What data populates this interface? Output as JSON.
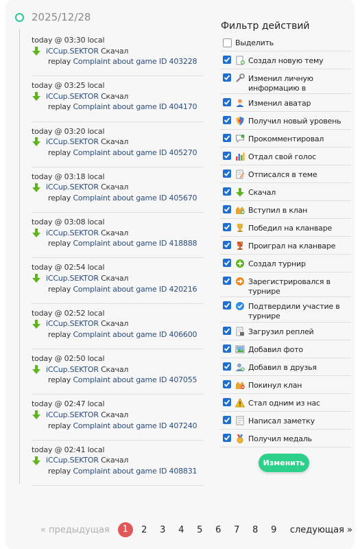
{
  "date": "2025/12/28",
  "colors": {
    "accent": "#2bc69a",
    "link": "#2a4c7d",
    "checkbox": "#1f6fd0",
    "button": "#2dd08a",
    "active_page": "#e25757"
  },
  "entries": [
    {
      "time": "today @ 03:30 local",
      "user": "iCCup.SEKTOR",
      "action": "Скачал",
      "prefix": "replay",
      "link": "Complaint about game ID 403228"
    },
    {
      "time": "today @ 03:25 local",
      "user": "iCCup.SEKTOR",
      "action": "Скачал",
      "prefix": "replay",
      "link": "Complaint about game ID 404170"
    },
    {
      "time": "today @ 03:20 local",
      "user": "iCCup.SEKTOR",
      "action": "Скачал",
      "prefix": "replay",
      "link": "Complaint about game ID 405270"
    },
    {
      "time": "today @ 03:18 local",
      "user": "iCCup.SEKTOR",
      "action": "Скачал",
      "prefix": "replay",
      "link": "Complaint about game ID 405670"
    },
    {
      "time": "today @ 03:08 local",
      "user": "iCCup.SEKTOR",
      "action": "Скачал",
      "prefix": "replay",
      "link": "Complaint about game ID 418888"
    },
    {
      "time": "today @ 02:54 local",
      "user": "iCCup.SEKTOR",
      "action": "Скачал",
      "prefix": "replay",
      "link": "Complaint about game ID 420216"
    },
    {
      "time": "today @ 02:52 local",
      "user": "iCCup.SEKTOR",
      "action": "Скачал",
      "prefix": "replay",
      "link": "Complaint about game ID 406600"
    },
    {
      "time": "today @ 02:50 local",
      "user": "iCCup.SEKTOR",
      "action": "Скачал",
      "prefix": "replay",
      "link": "Complaint about game ID 407055"
    },
    {
      "time": "today @ 02:47 local",
      "user": "iCCup.SEKTOR",
      "action": "Скачал",
      "prefix": "replay",
      "link": "Complaint about game ID 407240"
    },
    {
      "time": "today @ 02:41 local",
      "user": "iCCup.SEKTOR",
      "action": "Скачал",
      "prefix": "replay",
      "link": "Complaint about game ID 408831"
    }
  ],
  "filter": {
    "title": "Фильтр действий",
    "select_all": "Выделить",
    "items": [
      {
        "label": "Создал новую тему",
        "icon": "new-topic-icon"
      },
      {
        "label": "Изменил личную информацию в",
        "icon": "wrench-icon"
      },
      {
        "label": "Изменил аватар",
        "icon": "user-icon"
      },
      {
        "label": "Получил новый уровень",
        "icon": "shield-icon"
      },
      {
        "label": "Прокомментировал",
        "icon": "comment-icon"
      },
      {
        "label": "Отдал свой голос",
        "icon": "chart-icon"
      },
      {
        "label": "Отписался в теме",
        "icon": "note-icon"
      },
      {
        "label": "Скачал",
        "icon": "download-icon"
      },
      {
        "label": "Вступил в клан",
        "icon": "clan-join-icon"
      },
      {
        "label": "Победил на кланваре",
        "icon": "trophy-icon"
      },
      {
        "label": "Проиграл на кланваре",
        "icon": "trophy-red-icon"
      },
      {
        "label": "Создал турнир",
        "icon": "plus-circle-icon"
      },
      {
        "label": "Зарегистрировался в турнире",
        "icon": "arrow-circle-icon"
      },
      {
        "label": "Подтвердили участие в турнире",
        "icon": "check-circle-icon"
      },
      {
        "label": "Загрузил реплей",
        "icon": "upload-icon"
      },
      {
        "label": "Добавил фото",
        "icon": "photo-icon"
      },
      {
        "label": "Добавил в друзья",
        "icon": "add-friend-icon"
      },
      {
        "label": "Покинул клан",
        "icon": "clan-leave-icon"
      },
      {
        "label": "Стал одним из нас",
        "icon": "warning-icon"
      },
      {
        "label": "Написал заметку",
        "icon": "memo-icon"
      },
      {
        "label": "Получил медаль",
        "icon": "medal-icon"
      }
    ],
    "button": "Изменить"
  },
  "pagination": {
    "prev": "« предыдущая",
    "pages": [
      "1",
      "2",
      "3",
      "4",
      "5",
      "6",
      "7",
      "8",
      "9"
    ],
    "current": "1",
    "next": "следующая »"
  }
}
